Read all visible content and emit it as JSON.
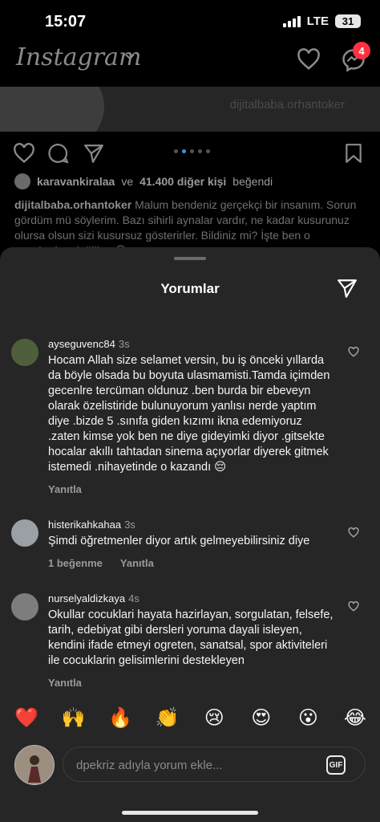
{
  "status_bar": {
    "time": "15:07",
    "network": "LTE",
    "battery": "31"
  },
  "header": {
    "app_name": "Instagram",
    "messages_badge": "4"
  },
  "post": {
    "watermark": "dijitalbaba.orhantoker",
    "likes_user": "karavankiralaa",
    "likes_connector": "ve",
    "likes_count": "41.400 diğer kişi",
    "likes_suffix": "beğendi",
    "caption_user": "dijitalbaba.orhantoker",
    "caption_text": "Malum bendeniz gerçekçi bir insanım. Sorun gördüm mü söylerim. Bazı sihirli aynalar vardır, ne kadar kusurunuz olursa olsun sizi kusursuz gösterirler. Bildiniz mi? İşte ben o aynalardan değilim. 😊"
  },
  "comments_sheet": {
    "title": "Yorumlar",
    "comments": [
      {
        "username": "ayseguvenc84",
        "time": "3s",
        "text": "Hocam Allah size selamet versin, bu iş önceki yıllarda da böyle olsada bu boyuta ulasmamisti.Tamda içimden gecenlre tercüman oldunuz .ben burda bir ebeveyn olarak özelistiride bulunuyorum yanlısı nerde yaptım diye .bizde 5 .sınıfa giden kızımı ikna edemiyoruz .zaten kimse yok ben ne diye gideyimki diyor .gitsekte hocalar akıllı tahtadan sinema açıyorlar diyerek gitmek istemedi .nihayetinde o kazandı 😔",
        "reply": "Yanıtla",
        "likes": ""
      },
      {
        "username": "histerikahkahaa",
        "time": "3s",
        "text": "Şimdi öğretmenler diyor artık gelmeyebilirsiniz diye",
        "reply": "Yanıtla",
        "likes": "1 beğenme"
      },
      {
        "username": "nurselyaldizkaya",
        "time": "4s",
        "text": "Okullar cocuklari hayata hazirlayan, sorgulatan, felsefe, tarih, edebiyat gibi dersleri yoruma dayali isleyen, kendini ifade etmeyi ogreten, sanatsal, spor aktiviteleri ile cocuklarin gelisimlerini destekleyen",
        "reply": "Yanıtla",
        "likes": ""
      }
    ],
    "emojis": [
      "❤️",
      "🙌",
      "🔥",
      "👏",
      "😢",
      "😍",
      "😮",
      "😂"
    ],
    "input_placeholder": "dpekriz adıyla yorum ekle...",
    "gif_label": "GIF"
  },
  "colors": {
    "background": "#000000",
    "sheet": "#262626",
    "badge": "#ff3040",
    "accent": "#3897f0"
  },
  "icons": [
    "heart-icon",
    "messenger-icon",
    "comment-icon",
    "share-icon",
    "bookmark-icon",
    "send-icon",
    "chevron-down-icon"
  ]
}
